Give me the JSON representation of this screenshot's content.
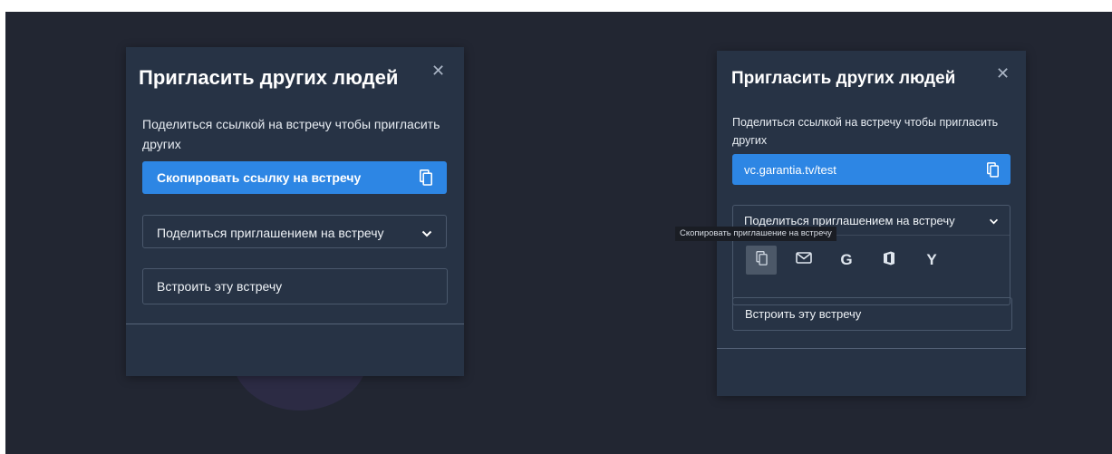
{
  "left_dialog": {
    "title": "Пригласить других людей",
    "close_glyph": "✕",
    "description": "Поделиться ссылкой на встречу чтобы пригласить других",
    "copy_button": {
      "label": "Скопировать ссылку на встречу",
      "icon": "copy-icon"
    },
    "share_dropdown": {
      "label": "Поделиться приглашением на встречу",
      "icon": "chevron-down-icon"
    },
    "embed_label": "Встроить эту встречу"
  },
  "right_dialog": {
    "title": "Пригласить других людей",
    "close_glyph": "✕",
    "description": "Поделиться ссылкой на встречу чтобы пригласить других",
    "link_field": {
      "value": "vc.garantia.tv/test",
      "icon": "copy-icon"
    },
    "share_dropdown": {
      "label": "Поделиться приглашением на встречу",
      "icon": "chevron-down-icon",
      "options": [
        {
          "name": "copy-invite",
          "icon": "copy-icon"
        },
        {
          "name": "email",
          "icon": "mail-icon"
        },
        {
          "name": "google",
          "icon": "google-icon",
          "glyph": "G"
        },
        {
          "name": "office",
          "icon": "office-icon"
        },
        {
          "name": "yahoo",
          "icon": "yahoo-icon",
          "glyph": "Y"
        }
      ]
    },
    "tooltip": "Скопировать приглашение на встречу",
    "embed_label": "Встроить эту встречу"
  },
  "colors": {
    "background": "#222632",
    "dialog": "#273345",
    "accent": "#2d86e4",
    "border": "#4a586c",
    "tooltip_bg": "#1a1d24"
  }
}
